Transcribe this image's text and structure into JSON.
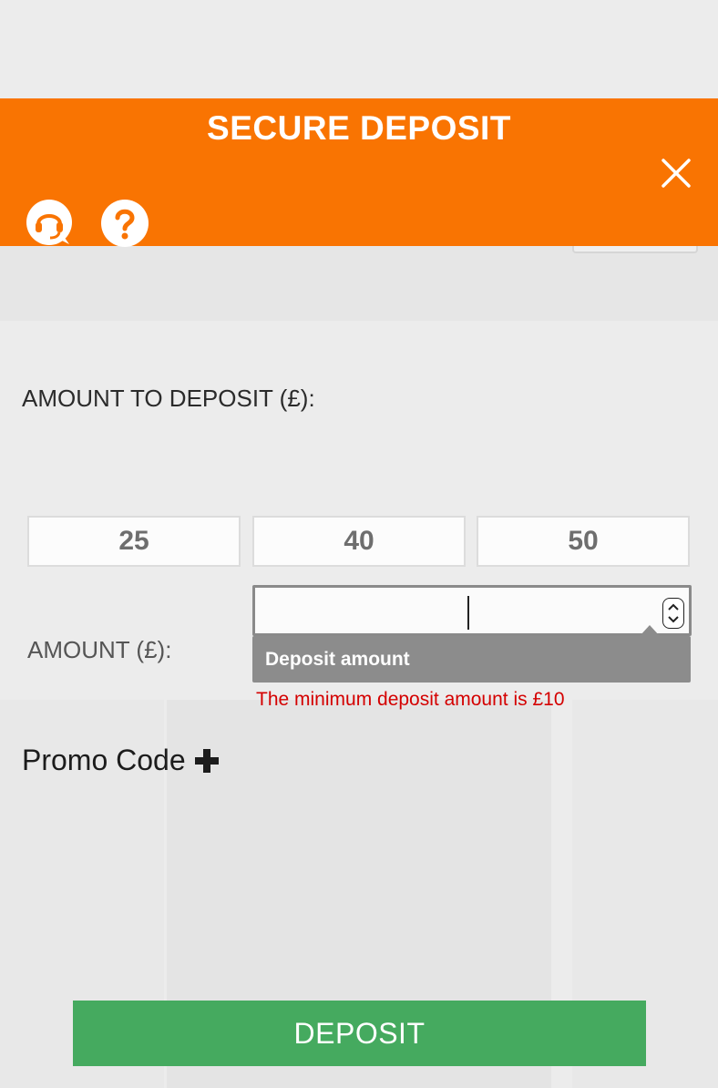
{
  "modal": {
    "title": "SECURE DEPOSIT",
    "header_color": "#f97402"
  },
  "header_icons": {
    "close": "close-icon",
    "support": "headset-chat-icon",
    "help": "question-mark-icon"
  },
  "deposit_form": {
    "amount_heading": "AMOUNT TO DEPOSIT (£):",
    "presets": [
      "25",
      "40",
      "50"
    ],
    "amount_label": "AMOUNT (£):",
    "amount_value": "",
    "tooltip": "Deposit amount",
    "error": "The minimum deposit amount is £10",
    "error_color": "#d40000",
    "promo_label": "Promo Code",
    "promo_icon": "plus-icon",
    "submit_label": "DEPOSIT",
    "submit_color": "#45aa5f"
  }
}
